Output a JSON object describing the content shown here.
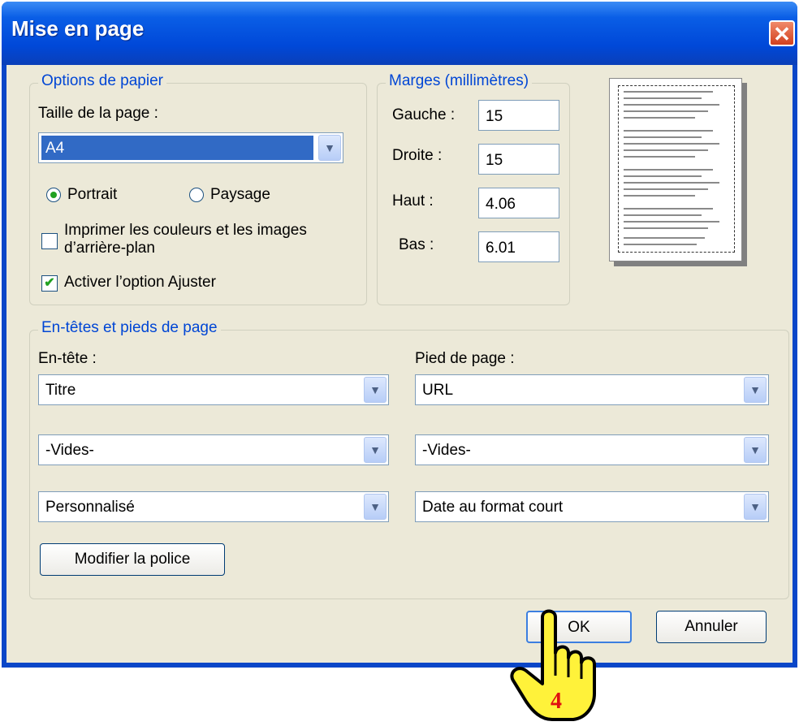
{
  "window": {
    "title": "Mise en page",
    "close": "✕"
  },
  "paper_options": {
    "legend": "Options de papier",
    "size_label": "Taille de la page :",
    "size_value": "A4",
    "orientation": {
      "portrait": "Portrait",
      "landscape": "Paysage",
      "selected": "Portrait"
    },
    "print_bg_label_1": "Imprimer les couleurs et les images",
    "print_bg_label_2": "d’arrière-plan",
    "print_bg_checked": false,
    "shrink_label": "Activer l’option Ajuster",
    "shrink_checked": true
  },
  "margins": {
    "legend": "Marges (millimètres)",
    "left_label": "Gauche :",
    "left_value": "15",
    "right_label": "Droite :",
    "right_value": "15",
    "top_label": "Haut :",
    "top_value": "4.06",
    "bottom_label": "Bas :",
    "bottom_value": "6.01"
  },
  "headers_footers": {
    "legend": "En-têtes et pieds de page",
    "header_label": "En-tête :",
    "footer_label": "Pied de page :",
    "header": [
      "Titre",
      "-Vides-",
      "Personnalisé"
    ],
    "footer": [
      "URL",
      "-Vides-",
      "Date au format court"
    ],
    "font_button": "Modifier la police"
  },
  "buttons": {
    "ok": "OK",
    "cancel": "Annuler"
  },
  "overlay": {
    "step_number": "4"
  },
  "icons": {
    "dropdown": "chevron-down-icon",
    "cursor": "hand-pointer-icon"
  }
}
